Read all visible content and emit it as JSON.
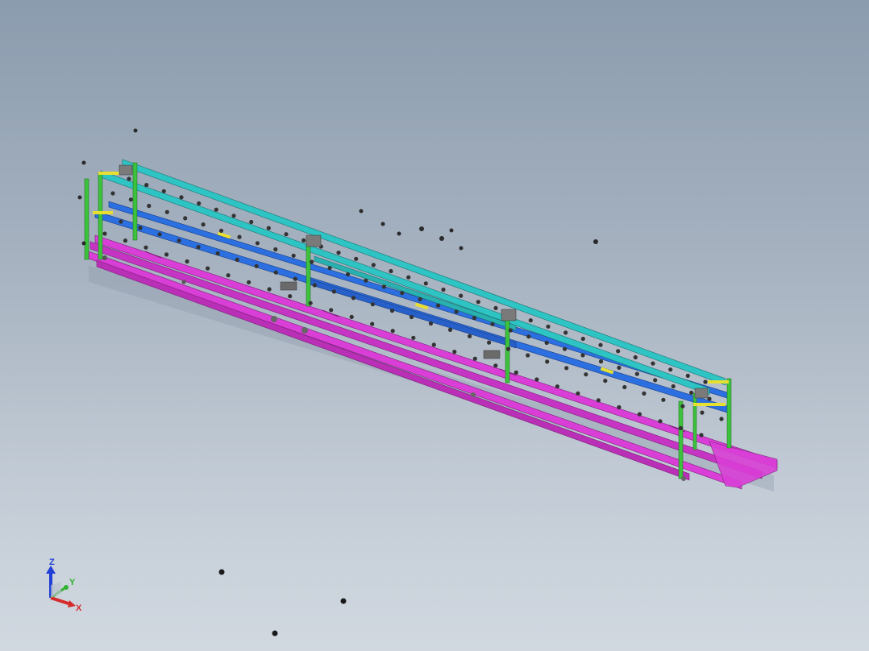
{
  "viewport": {
    "background_top": "#8b9cae",
    "background_bottom": "#d1d8e0"
  },
  "model": {
    "colors": {
      "frame_top": "#2fc4c4",
      "frame_middle": "#2c6fe0",
      "frame_bottom": "#d93fd6",
      "uprights": "#3cc23c",
      "brackets": "#e8e030",
      "fasteners": "#2a2a2a"
    }
  },
  "triad": {
    "z_label": "Z",
    "y_label": "Y",
    "x_label": "X",
    "z_color": "#1f3fd6",
    "y_color": "#2fb22f",
    "x_color": "#d62a2a"
  }
}
